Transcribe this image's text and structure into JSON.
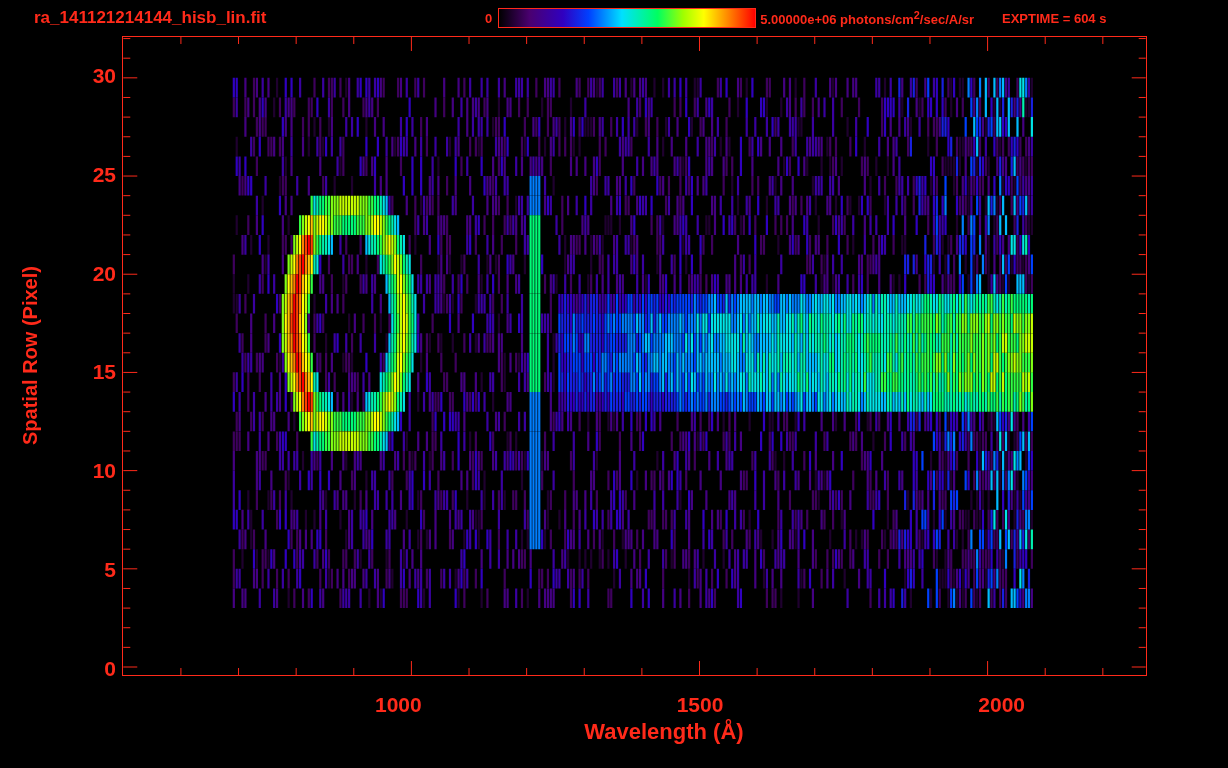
{
  "title": "ra_141121214144_hisb_lin.fit",
  "colorbar": {
    "min_label": "0",
    "max_label": "5.00000e+06 photons/cm$^{2}$/sec/A/sr"
  },
  "exposure": "EXPTIME = 604 s",
  "y_axis": {
    "label": "Spatial Row (Pixel)",
    "ticks": [
      "30",
      "25",
      "20",
      "15",
      "10",
      "5",
      "0"
    ]
  },
  "x_axis": {
    "label": "Wavelength (Å)",
    "ticks": [
      "1000",
      "1500",
      "2000"
    ]
  }
}
